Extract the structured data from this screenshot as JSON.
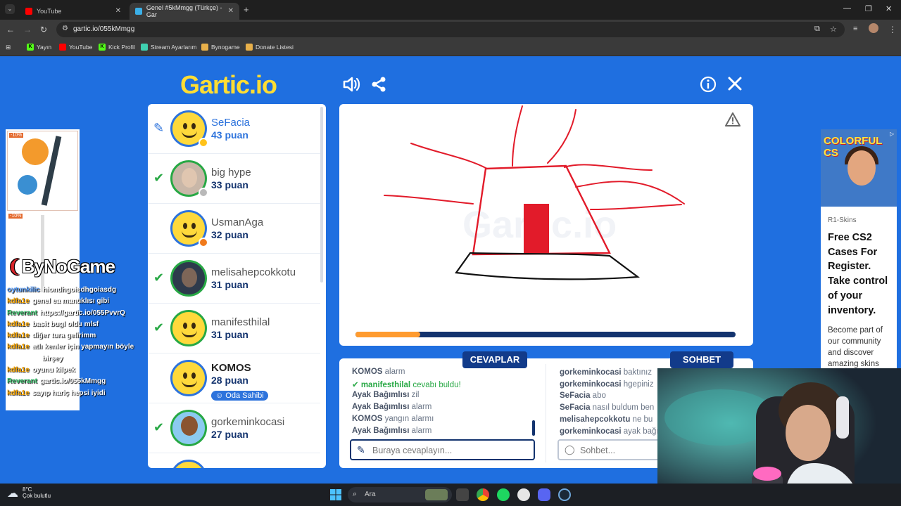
{
  "browser": {
    "tabs": [
      {
        "title": "YouTube",
        "close": "✕"
      },
      {
        "title": "Genel #5kMmgg (Türkçe) - Gar",
        "close": "✕"
      }
    ],
    "new_tab": "+",
    "url": "gartic.io/055kMmgg",
    "bookmarks": [
      "Yayın",
      "YouTube",
      "Kick Profil",
      "Stream Ayarlarım",
      "Bynogame",
      "Donate Listesi"
    ],
    "colors": {
      "accent": "#1f6fe0",
      "dark": "#13336e",
      "green": "#27a844",
      "orange": "#ff9b2f"
    }
  },
  "game": {
    "logo": "Gartic.io",
    "players": [
      {
        "name": "SeFacia",
        "score": "43 puan",
        "mark": "pen-icon",
        "avatar": "smiley",
        "status_color": "#ffc21a"
      },
      {
        "name": "big hype",
        "score": "33 puan",
        "mark": "check-icon",
        "avatar": "photo",
        "status_color": "#b9b9b9"
      },
      {
        "name": "UsmanAga",
        "score": "32 puan",
        "mark": "",
        "avatar": "smiley",
        "status_color": "#f07a1c"
      },
      {
        "name": "melisahepcokkotu",
        "score": "31 puan",
        "mark": "check-icon",
        "avatar": "photo",
        "status_color": ""
      },
      {
        "name": "manifesthilal",
        "score": "31 puan",
        "mark": "check-icon",
        "avatar": "smiley",
        "status_color": ""
      },
      {
        "name": "KOMOS",
        "score": "28 puan",
        "mark": "",
        "avatar": "smiley",
        "status_color": "",
        "badge": "Oda Sahibi"
      },
      {
        "name": "gorkeminkocasi",
        "score": "27 puan",
        "mark": "check-icon",
        "avatar": "boy",
        "status_color": ""
      }
    ],
    "round_progress": 0.17,
    "answers_tab": "CEVAPLAR",
    "chat_tab": "SOHBET",
    "answers": [
      {
        "user": "KOMOS",
        "text": "alarm"
      },
      {
        "user": "manifesthilal",
        "text": "cevabı buldu!",
        "correct": true
      },
      {
        "user": "Ayak Bağımlısı",
        "text": "zil"
      },
      {
        "user": "Ayak Bağımlısı",
        "text": "alarm"
      },
      {
        "user": "KOMOS",
        "text": "yangın alarmı"
      },
      {
        "user": "Ayak Bağımlısı",
        "text": "alarm"
      }
    ],
    "chat": [
      {
        "user": "gorkeminkocasi",
        "text": "baktınız"
      },
      {
        "user": "gorkeminkocasi",
        "text": "hgepiniz"
      },
      {
        "user": "SeFacia",
        "text": "abo"
      },
      {
        "user": "SeFacia",
        "text": "nasıl buldum ben"
      },
      {
        "user": "melisahepcokkotu",
        "text": "ne bu"
      },
      {
        "user": "gorkeminkocasi",
        "text": "ayak bağı"
      }
    ],
    "answer_placeholder": "Buraya cevaplayın...",
    "chat_placeholder": "Sohbet..."
  },
  "overlay": {
    "brand_prefix": "By",
    "brand_main": "NoGame",
    "discount_1": "-10%",
    "discount_2": "-10%",
    "stream_chat": [
      {
        "user": "oytunkilic",
        "text": "hiondhgoisdhgoiasdg"
      },
      {
        "user": "kdfa1e",
        "text": "genel ea mantıklısı gibi"
      },
      {
        "user": "Reverant",
        "text": "https://gartic.io/055PvvrQ"
      },
      {
        "user": "kdfa1e",
        "text": "basit bugl oldu mlsf"
      },
      {
        "user": "kdfa1e",
        "text": "diğer tura gelirimm"
      },
      {
        "user": "kdfa1e",
        "text": "atlı kenler için yapmayın böyle"
      },
      {
        "user": "",
        "text": "birşey"
      },
      {
        "user": "kdfa1e",
        "text": "oyunu kilpek"
      },
      {
        "user": "Reverant",
        "text": "gartic.io/055kMmgg"
      },
      {
        "user": "kdfa1e",
        "text": "sayıp hariç hepsi iyidi"
      }
    ]
  },
  "ad": {
    "headline_img": "COLORFUL CS",
    "source": "R1-Skins",
    "title": "Free CS2 Cases For Register. Take control of your inventory.",
    "body": "Become part of our community and discover amazing skins"
  },
  "taskbar": {
    "temp": "8°C",
    "weather": "Çok bulutlu",
    "search": "Ara"
  }
}
